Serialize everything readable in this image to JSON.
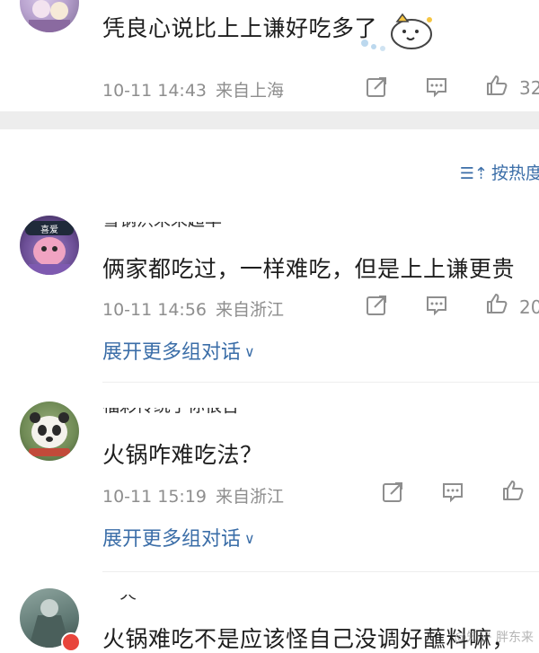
{
  "thread": [
    {
      "comment_text": "凭良心说比上上谦好吃多了",
      "date": "10-11 14:43",
      "location": "来自上海",
      "like_count": "32",
      "sticker": "cute-bear-sticker"
    },
    {
      "username": "雪钢洪末未超率",
      "comment_text": "俩家都吃过，一样难吃，但是上上谦更贵",
      "date": "10-11 14:56",
      "location": "来自浙江",
      "like_count": "20",
      "expand_label": "展开更多组对话"
    },
    {
      "username": "福彩传统了你很吉",
      "comment_text": "火锅咋难吃法？",
      "date": "10-11 15:19",
      "location": "来自浙江",
      "like_count": "",
      "expand_label": "展开更多组对话"
    },
    {
      "username": "—火—",
      "comment_text": "火锅难吃不是应该怪自己没调好蘸料嘛，"
    }
  ],
  "sort_label": "按热度",
  "watermark": "@知乎 胖东来",
  "colors": {
    "link_blue": "#3b6ea8",
    "meta_gray": "#8e8e8e",
    "section_gap": "#ededed"
  },
  "icons": {
    "share": "share-icon",
    "comment": "comment-icon",
    "like": "thumb-up-icon",
    "sort": "sort-icon",
    "chevron": "chevron-down-icon"
  }
}
